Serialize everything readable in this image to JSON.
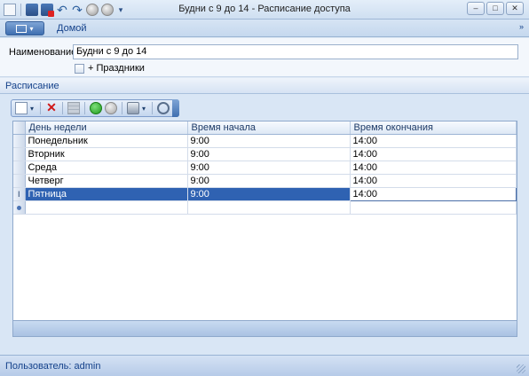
{
  "window": {
    "title": "Будни с 9 до 14 - Расписание доступа",
    "buttons": [
      "minimize",
      "maximize",
      "close"
    ]
  },
  "quick_access": {
    "icons": [
      "app-icon",
      "save-icon",
      "save-close-icon",
      "undo-icon",
      "redo-icon",
      "back-icon",
      "forward-icon"
    ],
    "undo_glyph": "↶",
    "redo_glyph": "↷",
    "dropdown_glyph": "▾"
  },
  "ribbon": {
    "app_menu_chevron": "▾",
    "tab_home": "Домой",
    "collapse_glyph": "»"
  },
  "form": {
    "name_label": "Наименование:",
    "name_value": "Будни с 9 до 14",
    "holidays_label": "+ Праздники",
    "holidays_checked": false
  },
  "group": {
    "title": "Расписание"
  },
  "toolbar": {
    "icons": [
      "new-icon",
      "delete-icon",
      "grid-icon",
      "ok-icon",
      "cancel-icon",
      "print-icon",
      "search-icon"
    ],
    "delete_glyph": "✕",
    "dropdown_glyph": "▾"
  },
  "grid": {
    "columns": [
      "День недели",
      "Время начала",
      "Время окончания"
    ],
    "rows": [
      {
        "day": "Понедельник",
        "start": "9:00",
        "end": "14:00"
      },
      {
        "day": "Вторник",
        "start": "9:00",
        "end": "14:00"
      },
      {
        "day": "Среда",
        "start": "9:00",
        "end": "14:00"
      },
      {
        "day": "Четверг",
        "start": "9:00",
        "end": "14:00"
      },
      {
        "day": "Пятница",
        "start": "9:00",
        "end": "14:00"
      }
    ],
    "selected_row_index": 4,
    "editing_indicator": "I"
  },
  "status": {
    "user_text": "Пользователь: admin"
  },
  "colors": {
    "selection": "#2f62b2",
    "accent": "#15428b"
  }
}
